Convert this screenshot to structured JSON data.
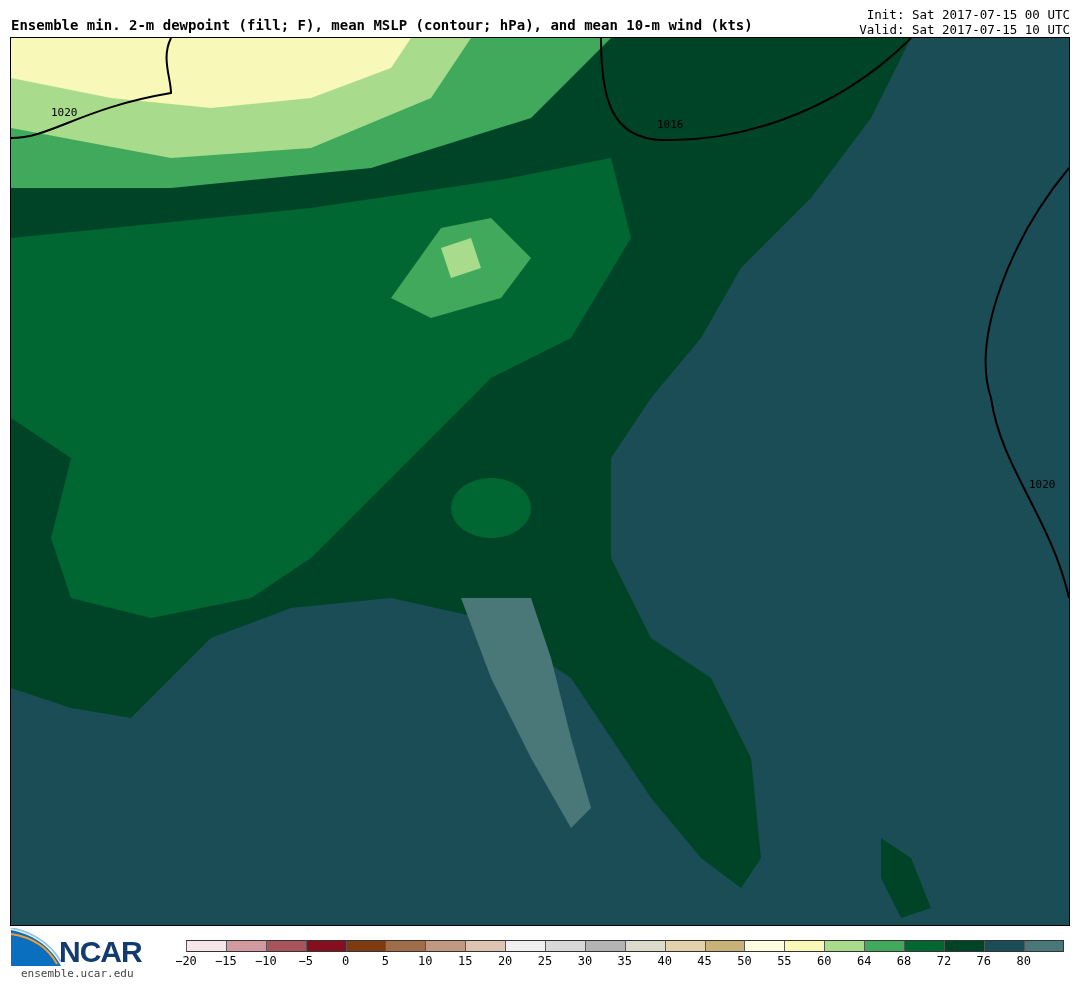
{
  "header": {
    "title": "Ensemble min. 2-m dewpoint (fill; F), mean MSLP (contour; hPa), and mean 10-m wind (kts)",
    "init": "Init: Sat 2017-07-15 00 UTC",
    "valid": "Valid: Sat 2017-07-15 10 UTC"
  },
  "map": {
    "contour_labels": [
      "1020",
      "1016",
      "1020"
    ]
  },
  "logo": {
    "text": "NCAR",
    "url": "ensemble.ucar.edu"
  },
  "colorbar": {
    "bins": [
      {
        "label": "−20",
        "color": "#f5e6ea"
      },
      {
        "label": "−15",
        "color": "#d09aa0"
      },
      {
        "label": "−10",
        "color": "#a8545c"
      },
      {
        "label": "−5",
        "color": "#850f1f"
      },
      {
        "label": "0",
        "color": "#7f3a10"
      },
      {
        "label": "5",
        "color": "#a06d4a"
      },
      {
        "label": "10",
        "color": "#c09a80"
      },
      {
        "label": "15",
        "color": "#dcc3b2"
      },
      {
        "label": "20",
        "color": "#f0f0f0"
      },
      {
        "label": "25",
        "color": "#d8d8d8"
      },
      {
        "label": "30",
        "color": "#b4b4b4"
      },
      {
        "label": "35",
        "color": "#dcdccc"
      },
      {
        "label": "40",
        "color": "#e2d2ac"
      },
      {
        "label": "45",
        "color": "#c8b27a"
      },
      {
        "label": "50",
        "color": "#fdfde0"
      },
      {
        "label": "55",
        "color": "#f8f8b8"
      },
      {
        "label": "60",
        "color": "#a8dc8c"
      },
      {
        "label": "64",
        "color": "#40a95c"
      },
      {
        "label": "68",
        "color": "#006632"
      },
      {
        "label": "72",
        "color": "#004428"
      },
      {
        "label": "76",
        "color": "#1b4d56"
      },
      {
        "label": "80",
        "color": "#4a7878"
      }
    ]
  }
}
